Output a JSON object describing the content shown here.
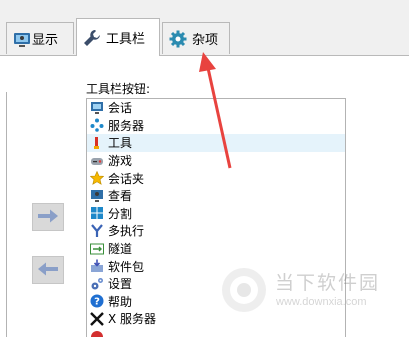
{
  "tabs": [
    {
      "label": "显示",
      "icon": "monitor-user-icon"
    },
    {
      "label": "工具栏",
      "icon": "wrench-icon",
      "active": true
    },
    {
      "label": "杂项",
      "icon": "gear-icon"
    }
  ],
  "toolbar_buttons": {
    "title": "工具栏按钮:",
    "items": [
      {
        "label": "会话",
        "icon": "session-icon"
      },
      {
        "label": "服务器",
        "icon": "server-icon"
      },
      {
        "label": "工具",
        "icon": "tools-icon",
        "selected": true
      },
      {
        "label": "游戏",
        "icon": "games-icon"
      },
      {
        "label": "会话夹",
        "icon": "star-folder-icon"
      },
      {
        "label": "查看",
        "icon": "view-icon"
      },
      {
        "label": "分割",
        "icon": "split-icon"
      },
      {
        "label": "多执行",
        "icon": "multiexec-icon"
      },
      {
        "label": "隧道",
        "icon": "tunnel-icon"
      },
      {
        "label": "软件包",
        "icon": "package-icon"
      },
      {
        "label": "设置",
        "icon": "settings-icon"
      },
      {
        "label": "帮助",
        "icon": "help-icon"
      },
      {
        "label": "X 服务器",
        "icon": "x-server-icon"
      }
    ]
  },
  "move_buttons": {
    "add_icon": "arrow-right-icon",
    "remove_icon": "arrow-left-icon"
  },
  "watermark": {
    "title": "当下软件园",
    "url": "www.downxia.com"
  },
  "colors": {
    "selection": "#e5f3fb",
    "annotation_arrow": "#e8433f",
    "arrow_button": "#d9d9d9"
  }
}
